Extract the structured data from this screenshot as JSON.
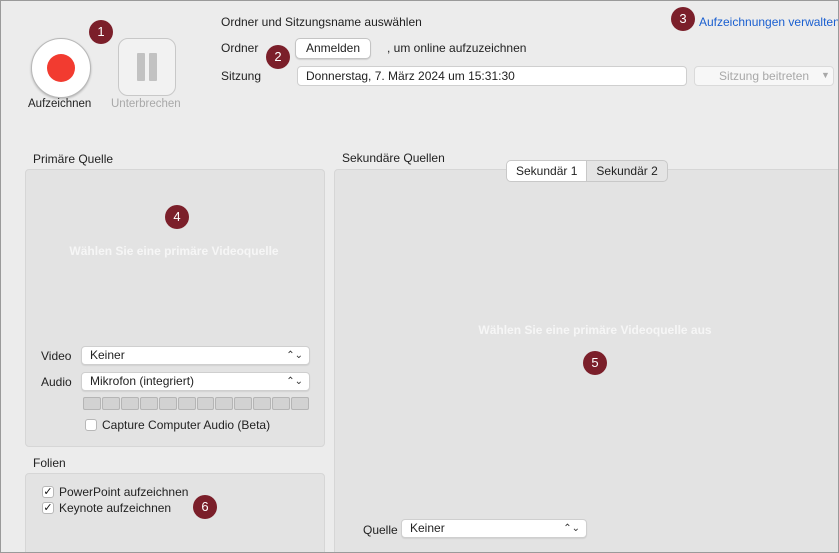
{
  "top": {
    "record_label": "Aufzeichnen",
    "pause_label": "Unterbrechen",
    "heading": "Ordner und Sitzungsname auswählen",
    "folder_label": "Ordner",
    "login_button": "Anmelden",
    "online_hint": ", um online aufzuzeichnen",
    "session_label": "Sitzung",
    "session_value": "Donnerstag, 7. März 2024 um 15:31:30",
    "join_button": "Sitzung beitreten",
    "manage_link": "Aufzeichnungen verwalten"
  },
  "primary": {
    "title": "Primäre Quelle",
    "placeholder": "Wählen Sie eine primäre Videoquelle",
    "video_label": "Video",
    "video_value": "Keiner",
    "audio_label": "Audio",
    "audio_value": "Mikrofon (integriert)",
    "audio_level_segments": 12,
    "capture_label": "Capture Computer Audio (Beta)",
    "capture_checked": false
  },
  "secondary": {
    "title": "Sekundäre Quellen",
    "tabs": [
      "Sekundär 1",
      "Sekundär 2"
    ],
    "active_tab": 0,
    "placeholder": "Wählen Sie eine primäre Videoquelle aus",
    "source_label": "Quelle",
    "source_value": "Keiner"
  },
  "slides": {
    "title": "Folien",
    "powerpoint_label": "PowerPoint aufzeichnen",
    "powerpoint_checked": true,
    "keynote_label": "Keynote aufzeichnen",
    "keynote_checked": true
  },
  "badges": [
    "1",
    "2",
    "3",
    "4",
    "5",
    "6"
  ],
  "colors": {
    "badge": "#7b1f2a",
    "record": "#f23b30",
    "link": "#1a5fd0"
  },
  "icons": {
    "select": "chevron-up-down-icon",
    "join": "chevron-down-icon",
    "check": "checkmark-icon"
  }
}
